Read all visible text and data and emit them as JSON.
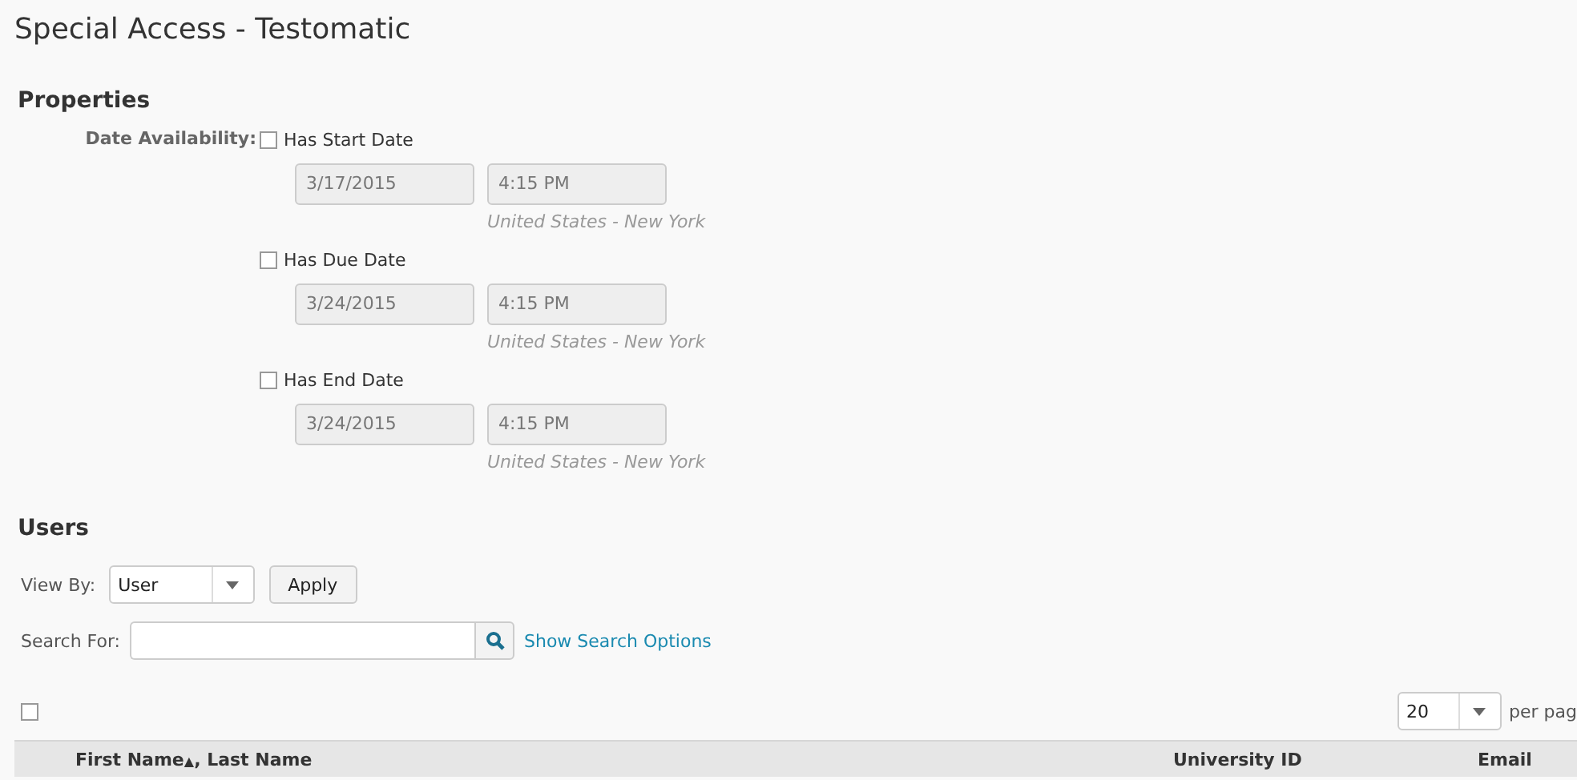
{
  "page_title": "Special Access - Testomatic",
  "properties": {
    "heading": "Properties",
    "label": "Date Availability:",
    "dates": [
      {
        "label": "Has Start Date",
        "checked": false,
        "date": "3/17/2015",
        "time": "4:15 PM",
        "timezone": "United States - New York"
      },
      {
        "label": "Has Due Date",
        "checked": false,
        "date": "3/24/2015",
        "time": "4:15 PM",
        "timezone": "United States - New York"
      },
      {
        "label": "Has End Date",
        "checked": false,
        "date": "3/24/2015",
        "time": "4:15 PM",
        "timezone": "United States - New York"
      }
    ]
  },
  "users": {
    "heading": "Users",
    "view_by": {
      "label": "View By:",
      "value": "User"
    },
    "apply": "Apply",
    "search": {
      "label": "Search For:",
      "link": "Show Search Options"
    },
    "select_all": {
      "checked": false
    },
    "per_page": {
      "value": "20",
      "label": "per pag"
    },
    "columns": [
      {
        "label": "First Name",
        "sort": "▲",
        "suffix": ", Last Name"
      },
      {
        "label": "University ID"
      },
      {
        "label": "Email"
      }
    ]
  }
}
